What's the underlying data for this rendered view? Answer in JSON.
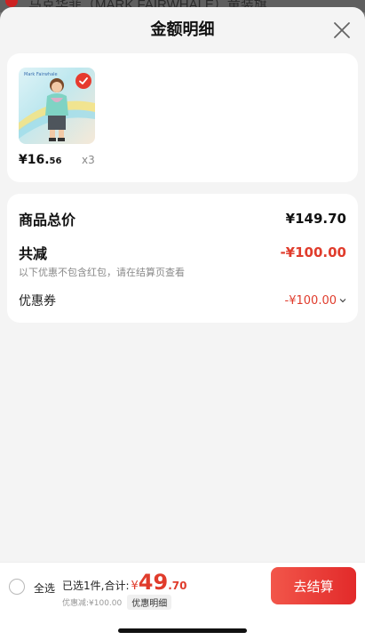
{
  "background_page": {
    "shop_line": "马克华菲（MARK FAIRWHALE）童装旗…"
  },
  "sheet": {
    "title": "金额明细"
  },
  "product": {
    "price_main": "¥16.",
    "price_cents": "56",
    "quantity": "x3",
    "image_brand_text": "Mark Fairwhale"
  },
  "summary": {
    "total_label": "商品总价",
    "total_value": "¥149.70",
    "discount_label": "共减",
    "discount_value": "-¥100.00",
    "discount_note": "以下优惠不包含红包，请在结算页查看",
    "coupon_label": "优惠券",
    "coupon_value": "-¥100.00"
  },
  "bottom_bar": {
    "select_all_label": "全选",
    "selected_text": "已选1件,合计:",
    "currency": "¥",
    "total_integer": "49",
    "total_decimal": ".70",
    "discount_text": "优惠减:¥100.00",
    "detail_label": "优惠明细",
    "checkout_label": "去结算"
  },
  "colors": {
    "accent": "#e03c2c",
    "checkout_start": "#f2564a",
    "checkout_end": "#e22a2a"
  }
}
